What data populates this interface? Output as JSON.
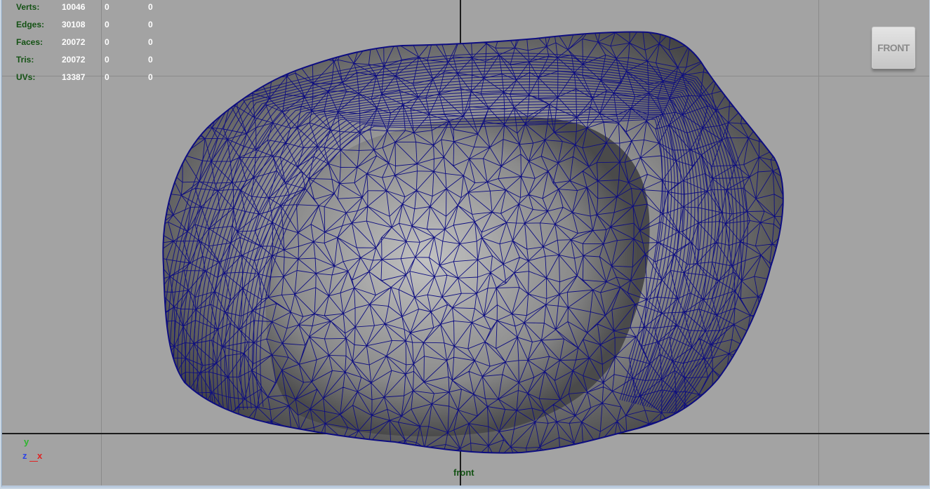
{
  "viewport": {
    "camera_name": "front",
    "view_cube_label": "FRONT",
    "background_color": "#a3a3a3",
    "wire_color": "#0d0d80"
  },
  "heads_up_display": {
    "rows": [
      {
        "label": "Verts:",
        "values": [
          "10046",
          "0",
          "0"
        ]
      },
      {
        "label": "Edges:",
        "values": [
          "30108",
          "0",
          "0"
        ]
      },
      {
        "label": "Faces:",
        "values": [
          "20072",
          "0",
          "0"
        ]
      },
      {
        "label": "Tris:",
        "values": [
          "20072",
          "0",
          "0"
        ]
      },
      {
        "label": "UVs:",
        "values": [
          "13387",
          "0",
          "0"
        ]
      }
    ]
  },
  "axis_gizmo": {
    "y": "y",
    "z": "z",
    "x": "x"
  }
}
